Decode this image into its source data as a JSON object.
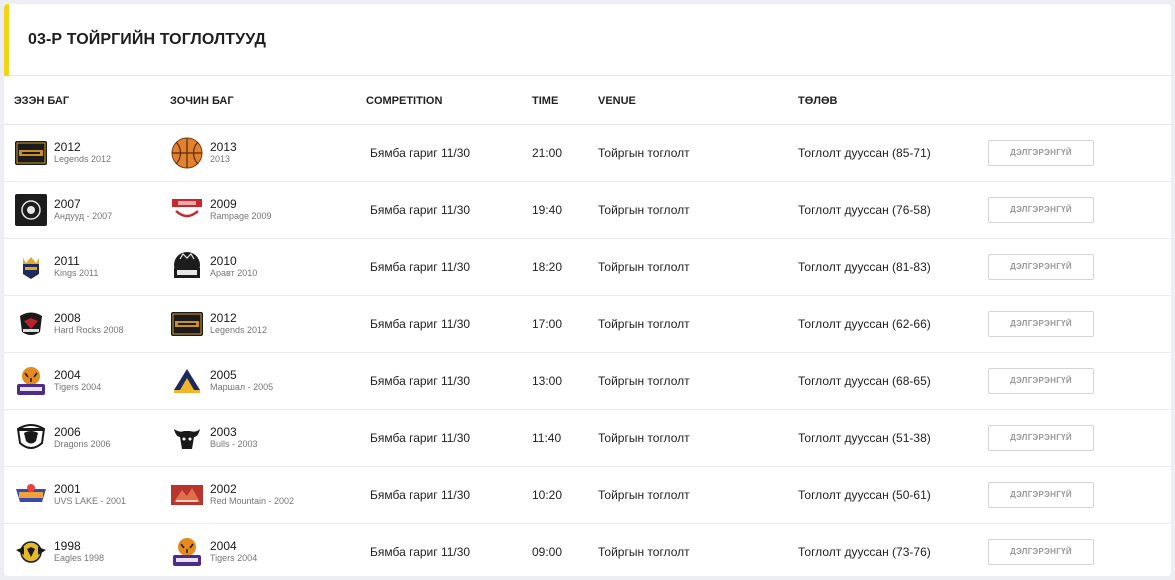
{
  "title": "03-Р ТОЙРГИЙН ТОГЛОЛТУУД",
  "colors": {
    "accent": "#f2d417"
  },
  "columns": {
    "home": "ЭЗЭН БАГ",
    "away": "ЗОЧИН БАГ",
    "competition": "COMPETITION",
    "time": "TIME",
    "venue": "VENUE",
    "status": "ТӨЛӨВ"
  },
  "matches": [
    {
      "home": {
        "year": "2012",
        "sub": "Legends 2012",
        "logo": "legends-logo"
      },
      "away": {
        "year": "2013",
        "sub": "2013",
        "logo": "basketball-logo"
      },
      "competition": "Бямба гариг 11/30",
      "time": "21:00",
      "venue": "Тойргын тоглолт",
      "status": "Тоглолт дууссан (85-71)",
      "action": "ДЭЛГЭРЭНГҮЙ"
    },
    {
      "home": {
        "year": "2007",
        "sub": "Андууд - 2007",
        "logo": "anduud-logo"
      },
      "away": {
        "year": "2009",
        "sub": "Rampage 2009",
        "logo": "rampage-logo"
      },
      "competition": "Бямба гариг 11/30",
      "time": "19:40",
      "venue": "Тойргын тоглолт",
      "status": "Тоглолт дууссан (76-58)",
      "action": "ДЭЛГЭРЭНГҮЙ"
    },
    {
      "home": {
        "year": "2011",
        "sub": "Kings 2011",
        "logo": "kings-logo"
      },
      "away": {
        "year": "2010",
        "sub": "Аравт 2010",
        "logo": "aravt-logo"
      },
      "competition": "Бямба гариг 11/30",
      "time": "18:20",
      "venue": "Тойргын тоглолт",
      "status": "Тоглолт дууссан (81-83)",
      "action": "ДЭЛГЭРЭНГҮЙ"
    },
    {
      "home": {
        "year": "2008",
        "sub": "Hard Rocks 2008",
        "logo": "hardrocks-logo"
      },
      "away": {
        "year": "2012",
        "sub": "Legends 2012",
        "logo": "legends-logo"
      },
      "competition": "Бямба гариг 11/30",
      "time": "17:00",
      "venue": "Тойргын тоглолт",
      "status": "Тоглолт дууссан (62-66)",
      "action": "ДЭЛГЭРЭНГҮЙ"
    },
    {
      "home": {
        "year": "2004",
        "sub": "Tigers 2004",
        "logo": "tigers-logo"
      },
      "away": {
        "year": "2005",
        "sub": "Маршал - 2005",
        "logo": "marshal-logo"
      },
      "competition": "Бямба гариг 11/30",
      "time": "13:00",
      "venue": "Тойргын тоглолт",
      "status": "Тоглолт дууссан (68-65)",
      "action": "ДЭЛГЭРЭНГҮЙ"
    },
    {
      "home": {
        "year": "2006",
        "sub": "Dragons 2006",
        "logo": "dragons-logo"
      },
      "away": {
        "year": "2003",
        "sub": "Bulls - 2003",
        "logo": "bulls-logo"
      },
      "competition": "Бямба гариг 11/30",
      "time": "11:40",
      "venue": "Тойргын тоглолт",
      "status": "Тоглолт дууссан (51-38)",
      "action": "ДЭЛГЭРЭНГҮЙ"
    },
    {
      "home": {
        "year": "2001",
        "sub": "UVS LAKE - 2001",
        "logo": "uvslake-logo"
      },
      "away": {
        "year": "2002",
        "sub": "Red Mountain - 2002",
        "logo": "redmountain-logo"
      },
      "competition": "Бямба гариг 11/30",
      "time": "10:20",
      "venue": "Тойргын тоглолт",
      "status": "Тоглолт дууссан (50-61)",
      "action": "ДЭЛГЭРЭНГҮЙ"
    },
    {
      "home": {
        "year": "1998",
        "sub": "Eagles 1998",
        "logo": "eagles-logo"
      },
      "away": {
        "year": "2004",
        "sub": "Tigers 2004",
        "logo": "tigers-logo"
      },
      "competition": "Бямба гариг 11/30",
      "time": "09:00",
      "venue": "Тойргын тоглолт",
      "status": "Тоглолт дууссан (73-76)",
      "action": "ДЭЛГЭРЭНГҮЙ"
    }
  ]
}
